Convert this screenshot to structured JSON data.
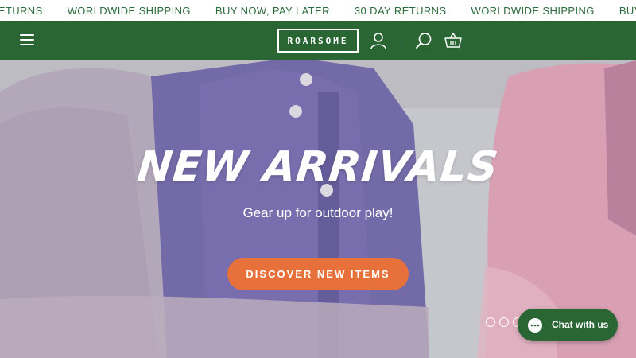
{
  "announcement": {
    "items": [
      "RETURNS",
      "WORLDWIDE SHIPPING",
      "BUY NOW, PAY LATER",
      "30 DAY RETURNS",
      "WORLDWIDE SHIPPING",
      "BUY NOW, PAY LATER"
    ]
  },
  "header": {
    "logo_text": "ROARSOME",
    "icons": [
      "menu-icon",
      "account-icon",
      "search-icon",
      "basket-icon"
    ]
  },
  "hero": {
    "title": "NEW ARRIVALS",
    "subtitle": "Gear up for outdoor play!",
    "cta_label": "DISCOVER NEW ITEMS",
    "slide_count": 3
  },
  "chat": {
    "label": "Chat with us"
  },
  "colors": {
    "brand_green": "#2a6534",
    "announcement_text": "#2c6b3c",
    "cta_orange": "#e8703a"
  }
}
